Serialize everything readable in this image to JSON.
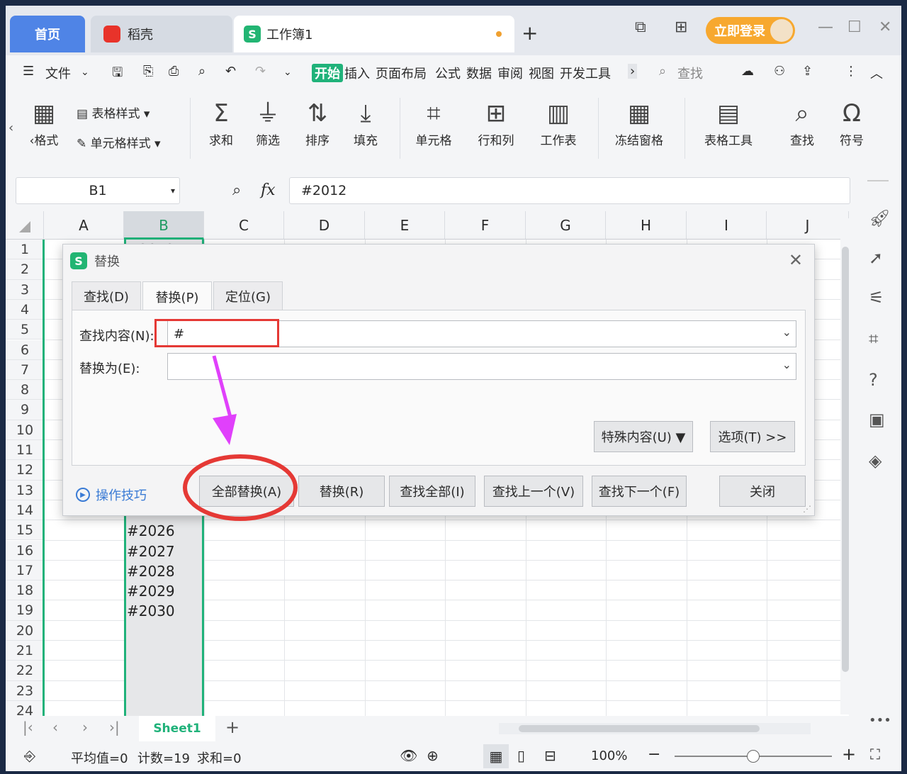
{
  "tabs": {
    "home": "首页",
    "daoke": "稻壳",
    "workbook": "工作簿1",
    "new_tab": "+"
  },
  "titlebar": {
    "login": "立即登录"
  },
  "menu": {
    "file": "文件",
    "start": "开始",
    "items": [
      "插入",
      "页面布局",
      "公式",
      "数据",
      "审阅",
      "视图",
      "开发工具"
    ],
    "search": "查找"
  },
  "ribbon": {
    "format": "‹格式",
    "table_style": "表格样式",
    "cell_style": "单元格样式",
    "sum": "求和",
    "filter": "筛选",
    "sort": "排序",
    "fill": "填充",
    "cell": "单元格",
    "rowcol": "行和列",
    "sheet": "工作表",
    "freeze": "冻结窗格",
    "tools": "表格工具",
    "find": "查找",
    "symbol": "符号"
  },
  "formula": {
    "cell_ref": "B1",
    "fx": "fx",
    "value": "#2012"
  },
  "columns": [
    "A",
    "B",
    "C",
    "D",
    "E",
    "F",
    "G",
    "H",
    "I",
    "J"
  ],
  "rows": [
    "1",
    "2",
    "3",
    "4",
    "5",
    "6",
    "7",
    "8",
    "9",
    "10",
    "11",
    "12",
    "13",
    "14",
    "15",
    "16",
    "17",
    "18",
    "19",
    "20",
    "21",
    "22",
    "23",
    "24"
  ],
  "b_values": [
    {
      "row": "15",
      "v": "#2026"
    },
    {
      "row": "16",
      "v": "#2027"
    },
    {
      "row": "17",
      "v": "#2028"
    },
    {
      "row": "18",
      "v": "#2029"
    },
    {
      "row": "19",
      "v": "#2030"
    }
  ],
  "b_row1_partial": "#2012",
  "dialog": {
    "title": "替换",
    "tabs": [
      "查找(D)",
      "替换(P)",
      "定位(G)"
    ],
    "find_label": "查找内容(N):",
    "find_value": "#",
    "replace_label": "替换为(E):",
    "replace_value": "",
    "special": "特殊内容(U) ▼",
    "options": "选项(T) >>",
    "tips": "操作技巧",
    "buttons": {
      "replace_all": "全部替换(A)",
      "replace": "替换(R)",
      "find_all": "查找全部(I)",
      "find_prev": "查找上一个(V)",
      "find_next": "查找下一个(F)",
      "close": "关闭"
    }
  },
  "sheet": {
    "name": "Sheet1"
  },
  "status": {
    "avg": "平均值=0",
    "count": "计数=19",
    "sum": "求和=0",
    "zoom": "100%"
  },
  "colors": {
    "accent": "#20b27a",
    "home_tab": "#4f84e6",
    "login": "#f7a82f",
    "highlight": "#e53935",
    "arrow": "#e040fb"
  }
}
